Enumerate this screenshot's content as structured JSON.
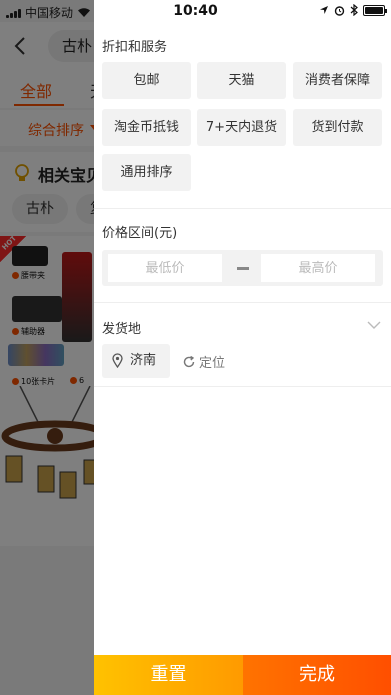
{
  "status_bar": {
    "carrier": "中国移动",
    "time": "10:40"
  },
  "search": {
    "query": "古朴",
    "query_tail": "古朴"
  },
  "tabs": [
    {
      "label": "全部",
      "active": true
    },
    {
      "label": "天",
      "active": false
    }
  ],
  "sort": {
    "label": "综合排序"
  },
  "related": {
    "title": "相关宝贝",
    "chips": [
      "古朴",
      "复"
    ]
  },
  "products": [
    {
      "badge": "HOT",
      "captions": [
        "腰带夹",
        "辅助器",
        "10张卡片"
      ]
    },
    {
      "captions": [
        "6"
      ]
    }
  ],
  "filter": {
    "discount_title": "折扣和服务",
    "tags": [
      {
        "label": "包邮"
      },
      {
        "label": "天猫"
      },
      {
        "label": "消费者保障"
      },
      {
        "label": "淘金币抵钱"
      },
      {
        "label": "7+天内退货"
      },
      {
        "label": "货到付款"
      },
      {
        "label": "通用排序"
      }
    ],
    "price_title": "价格区间(元)",
    "price_min_placeholder": "最低价",
    "price_max_placeholder": "最高价",
    "shipping_title": "发货地",
    "location": "济南",
    "locate_label": "定位",
    "reset_label": "重置",
    "done_label": "完成"
  },
  "colors": {
    "accent": "#ff5000",
    "reset_gradient": [
      "#ffc200",
      "#ff9a00"
    ],
    "done_gradient": [
      "#ff7300",
      "#ff4f00"
    ]
  }
}
